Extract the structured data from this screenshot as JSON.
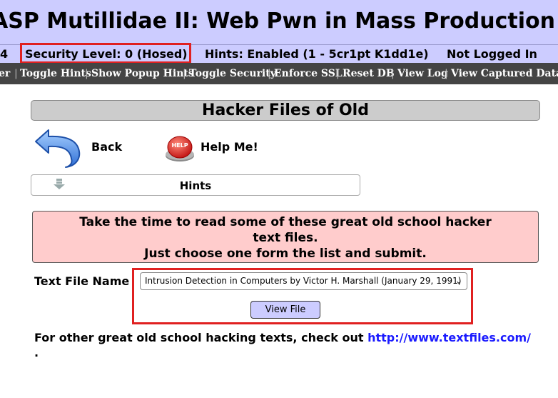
{
  "header": {
    "title": "ASP Mutillidae II: Web Pwn in Mass Production"
  },
  "status_bar": {
    "version_fragment": "4",
    "security_level": "Security Level: 0 (Hosed)",
    "hints": "Hints: Enabled (1 - 5cr1pt K1dd1e)",
    "login_status": "Not Logged In"
  },
  "menu": {
    "items": [
      "er",
      "Toggle Hints",
      "Show Popup Hints",
      "Toggle Security",
      "Enforce SSL",
      "Reset DB",
      "View Log",
      "View Captured Data"
    ]
  },
  "page": {
    "title": "Hacker Files of Old",
    "back_label": "Back",
    "help_label": "Help Me!",
    "help_icon_text": "HELP",
    "hints_label": "Hints",
    "info_line1": "Take the time to read some of these great old school hacker",
    "info_line2": "text files.",
    "info_line3": "Just choose one form the list and submit."
  },
  "form": {
    "label": "Text File Name",
    "selected_value": "Intrusion Detection in Computers by Victor H. Marshall (January 29, 1991)",
    "submit_label": "View File"
  },
  "footer": {
    "text": "For other great old school hacking texts, check out ",
    "link_text": "http://www.textfiles.com/",
    "trailing": "."
  },
  "colors": {
    "header_bg": "#ccccff",
    "menu_bg": "#444444",
    "highlight_border": "#e02020",
    "info_bg": "#ffcccc",
    "link": "#1a1aff"
  }
}
